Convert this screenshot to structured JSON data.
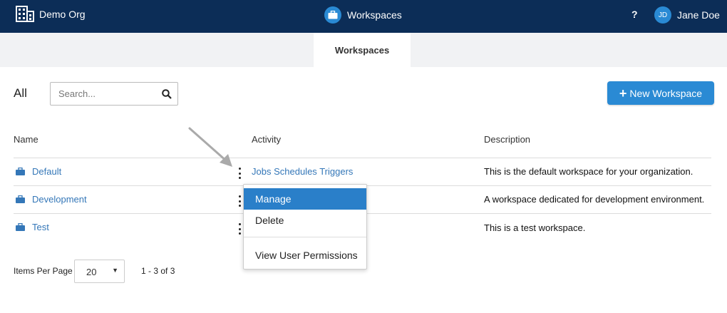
{
  "topbar": {
    "org_name": "Demo Org",
    "org_icon": "building-icon",
    "app_title": "Workspaces",
    "app_icon": "briefcase-icon",
    "help_label": "?",
    "user_initials": "JD",
    "user_name": "Jane Doe"
  },
  "tabs": [
    {
      "label": "Workspaces",
      "active": true
    }
  ],
  "filter": {
    "label": "All",
    "search_placeholder": "Search..."
  },
  "new_button_label": "New Workspace",
  "table": {
    "columns": [
      "Name",
      "Activity",
      "Description"
    ],
    "rows": [
      {
        "name": "Default",
        "activity": [
          "Jobs",
          "Schedules",
          "Triggers"
        ],
        "description": "This is the default workspace for your organization."
      },
      {
        "name": "Development",
        "activity": [],
        "description": "A workspace dedicated for development environment."
      },
      {
        "name": "Test",
        "activity": [],
        "description": "This is a test workspace."
      }
    ]
  },
  "context_menu": {
    "items": [
      "Manage",
      "Delete",
      "View User Permissions"
    ],
    "highlighted": "Manage"
  },
  "pagination": {
    "items_per_page_label": "Items Per Page",
    "items_per_page": "20",
    "range": "1 - 3 of 3"
  },
  "colors": {
    "topbar": "#0c2d57",
    "accent": "#2a8ad4",
    "link": "#3477b8"
  }
}
